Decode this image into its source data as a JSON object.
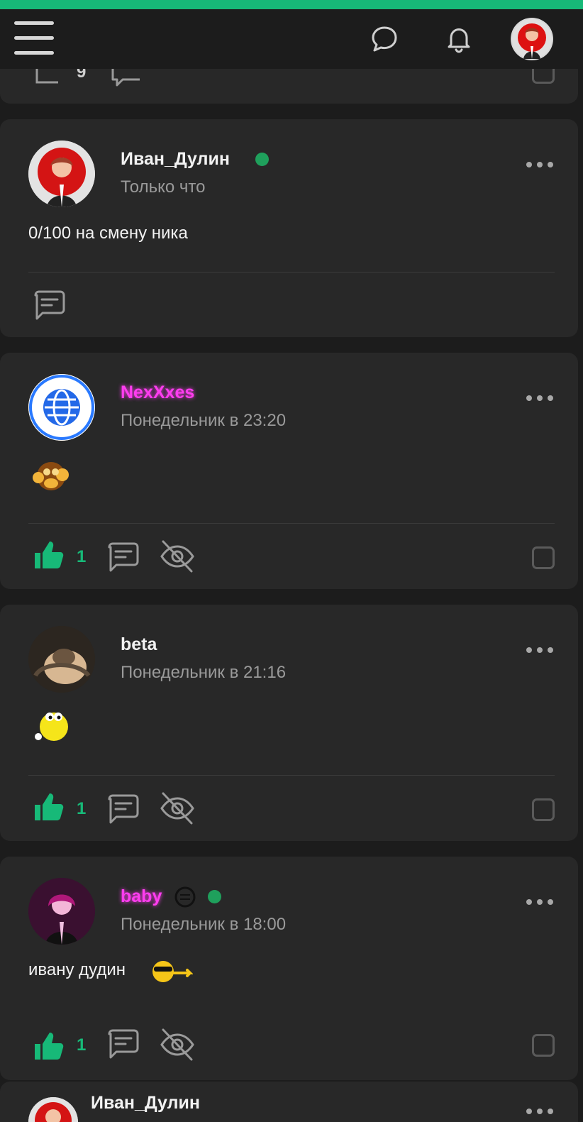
{
  "colors": {
    "accent": "#17b978",
    "background": "#1c1c1c",
    "card": "#282828",
    "magenta_name": "#ff3df0"
  },
  "header": {
    "menu_icon": "hamburger-icon",
    "chat_icon": "chat-bubble-icon",
    "bell_icon": "bell-icon",
    "profile_avatar": "user-avatar"
  },
  "prev_post": {
    "likes": "9"
  },
  "posts": [
    {
      "author": "Иван_Дулин",
      "online": true,
      "time": "Только что",
      "text": "0/100 на смену ника"
    },
    {
      "author": "NexXxes",
      "time": "Понедельник в 23:20",
      "emoji": "monkey-sticker",
      "likes": "1"
    },
    {
      "author": "beta",
      "time": "Понедельник в 21:16",
      "emoji": "yellow-smiley-sticker",
      "likes": "1"
    },
    {
      "author": "baby",
      "online": true,
      "time": "Понедельник в 18:00",
      "text": "ивану дудин",
      "emoji": "cool-smiley-sticker",
      "likes": "1"
    },
    {
      "author": "Иван_Дулин"
    }
  ]
}
